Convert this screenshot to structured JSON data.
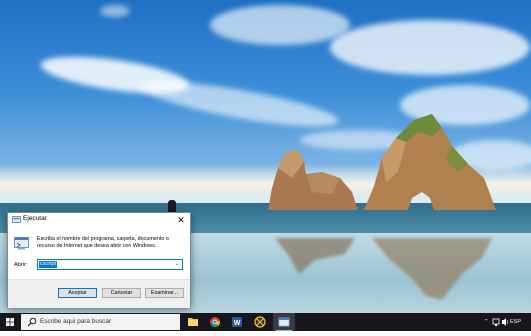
{
  "run_dialog": {
    "title": "Ejecutar",
    "close_glyph": "✕",
    "description": "Escriba el nombre del programa, carpeta, documento o recurso de Internet que desea abrir con Windows.",
    "open_label": "Abrir:",
    "open_value": "cscript",
    "ok_label": "Aceptar",
    "cancel_label": "Cancelar",
    "browse_label": "Examinar...",
    "dropdown_glyph": "⌄"
  },
  "taskbar": {
    "search_placeholder": "Escribe aquí para buscar",
    "apps": [
      {
        "name": "file-explorer-icon"
      },
      {
        "name": "chrome-icon"
      },
      {
        "name": "word-icon"
      },
      {
        "name": "app-icon"
      },
      {
        "name": "run-app-icon",
        "active": true
      }
    ],
    "tray": {
      "chevron": "⌃",
      "language": "ESP"
    }
  },
  "colors": {
    "accent": "#0078d7",
    "taskbar": "#16161c"
  }
}
